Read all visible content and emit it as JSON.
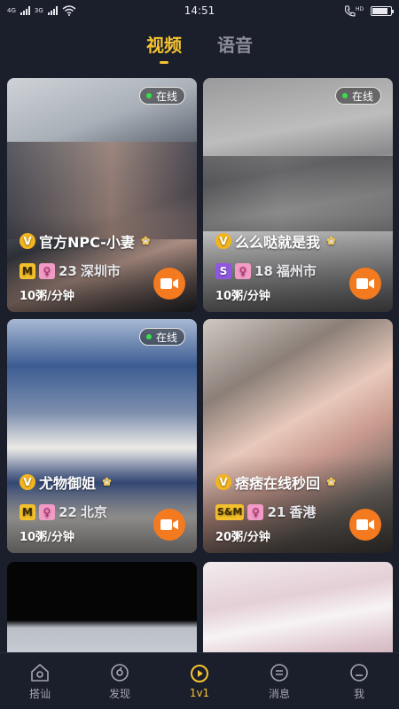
{
  "status_bar": {
    "time": "14:51",
    "net_labels": [
      "4G",
      "3G"
    ],
    "hd_label": "HD",
    "battery_level": 0.85
  },
  "tabs": [
    {
      "label": "视频",
      "active": true
    },
    {
      "label": "语音",
      "active": false
    }
  ],
  "cards": [
    {
      "name": "官方NPC-小妻",
      "vip": "V",
      "role": "M",
      "gender_icon": "female-icon",
      "age": "23",
      "city": "深圳市",
      "price": "10粥/分钟",
      "online": true,
      "online_label": "在线",
      "badge": "flower-icon"
    },
    {
      "name": "么么哒就是我",
      "vip": "V",
      "role": "S",
      "gender_icon": "female-icon",
      "age": "18",
      "city": "福州市",
      "price": "10粥/分钟",
      "online": true,
      "online_label": "在线",
      "badge": "flower-icon"
    },
    {
      "name": "尤物御姐",
      "vip": "V",
      "role": "M",
      "gender_icon": "female-icon",
      "age": "22",
      "city": "北京",
      "price": "10粥/分钟",
      "online": true,
      "online_label": "在线",
      "badge": "flower-icon"
    },
    {
      "name": "痞痞在线秒回",
      "vip": "V",
      "role": "S&M",
      "gender_icon": "female-icon",
      "age": "21",
      "city": "香港",
      "price": "20粥/分钟",
      "online": false,
      "badge": "flower-icon"
    }
  ],
  "nav": [
    {
      "label": "搭讪",
      "icon": "home-icon",
      "active": false
    },
    {
      "label": "发现",
      "icon": "discover-icon",
      "active": false
    },
    {
      "label": "1v1",
      "icon": "play-icon",
      "active": true
    },
    {
      "label": "消息",
      "icon": "message-icon",
      "active": false
    },
    {
      "label": "我",
      "icon": "profile-icon",
      "active": false
    }
  ],
  "colors": {
    "accent": "#f6c431",
    "background": "#1b1e2b",
    "call_button": "#f37a1f",
    "online_dot": "#36e04a"
  }
}
